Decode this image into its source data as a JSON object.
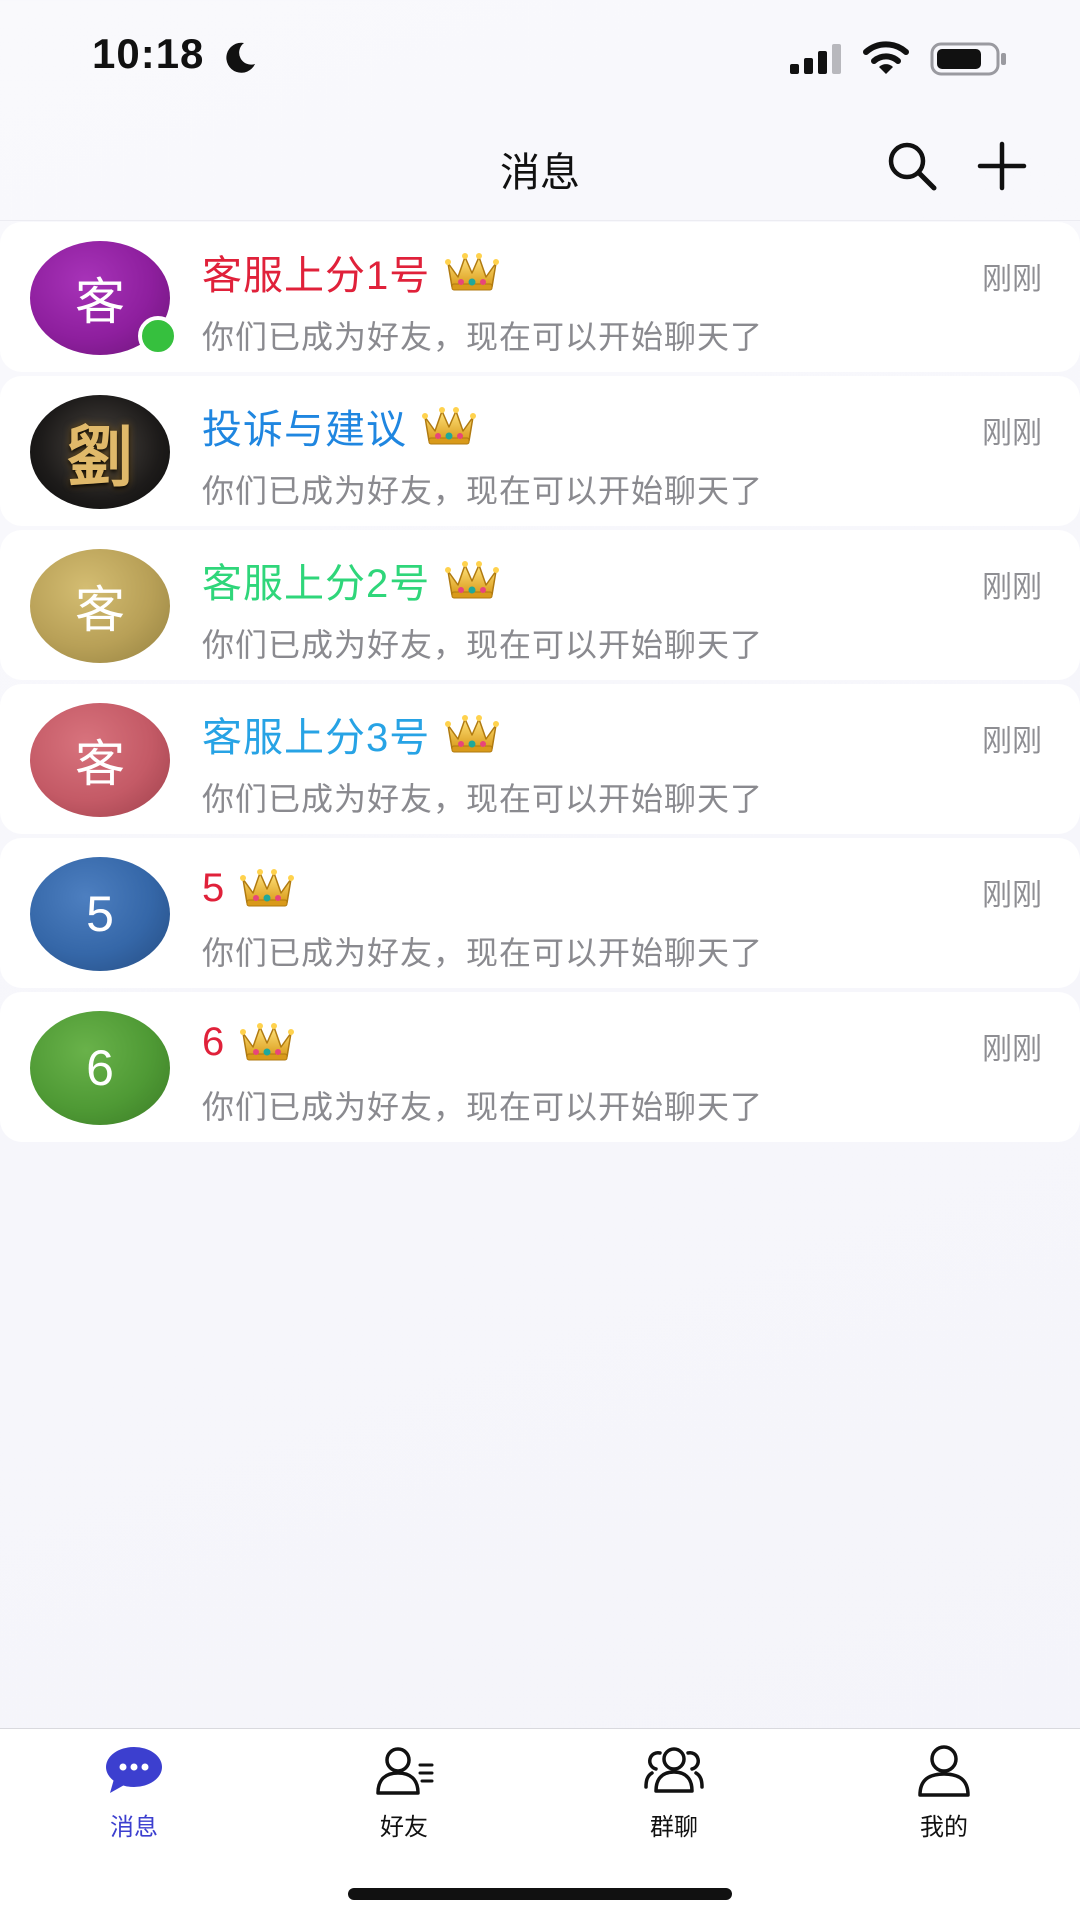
{
  "status_bar": {
    "time": "10:18"
  },
  "header": {
    "title": "消息"
  },
  "chats": [
    {
      "name": "客服上分1号",
      "name_color": "#e0213a",
      "avatar_text": "客",
      "avatar_color": "#8e1f9e",
      "online": true,
      "time": "刚刚",
      "preview": "你们已成为好友，现在可以开始聊天了"
    },
    {
      "name": "投诉与建议",
      "name_color": "#1f86e0",
      "avatar_text": "劉",
      "avatar_color": "#1d1b1a",
      "online": false,
      "time": "刚刚",
      "preview": "你们已成为好友，现在可以开始聊天了"
    },
    {
      "name": "客服上分2号",
      "name_color": "#2fd67a",
      "avatar_text": "客",
      "avatar_color": "#b8a057",
      "online": false,
      "time": "刚刚",
      "preview": "你们已成为好友，现在可以开始聊天了"
    },
    {
      "name": "客服上分3号",
      "name_color": "#27a3e5",
      "avatar_text": "客",
      "avatar_color": "#c45a66",
      "online": false,
      "time": "刚刚",
      "preview": "你们已成为好友，现在可以开始聊天了"
    },
    {
      "name": "5",
      "name_color": "#e0213a",
      "avatar_text": "5",
      "avatar_color": "#3567a8",
      "online": false,
      "time": "刚刚",
      "preview": "你们已成为好友，现在可以开始聊天了"
    },
    {
      "name": "6",
      "name_color": "#e0213a",
      "avatar_text": "6",
      "avatar_color": "#4f9a35",
      "online": false,
      "time": "刚刚",
      "preview": "你们已成为好友，现在可以开始聊天了"
    }
  ],
  "tab_bar": {
    "active_color": "#3c3fcf",
    "tabs": [
      {
        "label": "消息",
        "icon": "chat-bubble-icon",
        "active": true
      },
      {
        "label": "好友",
        "icon": "friends-icon",
        "active": false
      },
      {
        "label": "群聊",
        "icon": "group-icon",
        "active": false
      },
      {
        "label": "我的",
        "icon": "profile-icon",
        "active": false
      }
    ]
  }
}
